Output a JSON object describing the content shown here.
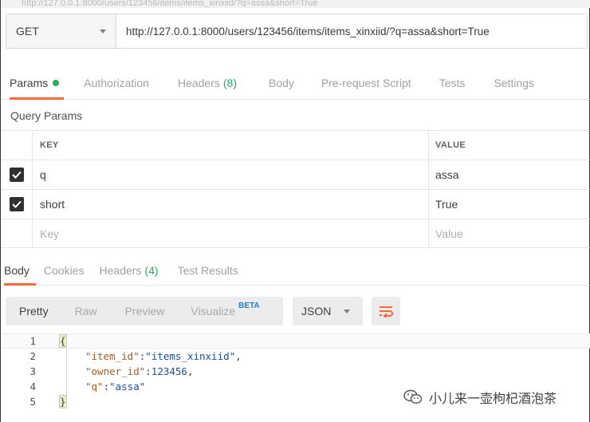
{
  "request": {
    "method": "GET",
    "url": "http://127.0.0.1:8000/users/123456/items/items_xinxiid/?q=assa&short=True",
    "top_strip_text": "http://127.0.0.1:8000/users/123456/items/items_xinxiid/?q=assa&short=True"
  },
  "request_tabs": [
    {
      "label": "Params",
      "active": true,
      "dot": true
    },
    {
      "label": "Authorization"
    },
    {
      "label": "Headers",
      "count": "(8)"
    },
    {
      "label": "Body"
    },
    {
      "label": "Pre-request Script"
    },
    {
      "label": "Tests"
    },
    {
      "label": "Settings"
    }
  ],
  "query_params": {
    "title": "Query Params",
    "columns": {
      "key": "KEY",
      "value": "VALUE"
    },
    "rows": [
      {
        "key": "q",
        "value": "assa",
        "checked": true
      },
      {
        "key": "short",
        "value": "True",
        "checked": true
      }
    ],
    "new_row": {
      "key_placeholder": "Key",
      "value_placeholder": "Value"
    }
  },
  "response_tabs": [
    {
      "label": "Body",
      "active": true
    },
    {
      "label": "Cookies"
    },
    {
      "label": "Headers",
      "count": "(4)"
    },
    {
      "label": "Test Results"
    }
  ],
  "view_options": [
    {
      "label": "Pretty",
      "active": true
    },
    {
      "label": "Raw"
    },
    {
      "label": "Preview"
    },
    {
      "label": "Visualize",
      "badge": "BETA"
    }
  ],
  "format": "JSON",
  "code": {
    "line_numbers": [
      "1",
      "2",
      "3",
      "4",
      "5"
    ],
    "open_brace": "{",
    "close_brace": "}",
    "fields": [
      {
        "key": "\"item_id\"",
        "value": "\"items_xinxiid\"",
        "type": "string",
        "comma": ","
      },
      {
        "key": "\"owner_id\"",
        "value": "123456",
        "type": "number",
        "comma": ","
      },
      {
        "key": "\"q\"",
        "value": "\"assa\"",
        "type": "string",
        "comma": ""
      }
    ]
  },
  "watermark": "小儿来一壶枸杞酒泡茶",
  "colors": {
    "accent": "#f26b3a",
    "count_green": "#27ae60",
    "beta_blue": "#2a7ad6"
  }
}
